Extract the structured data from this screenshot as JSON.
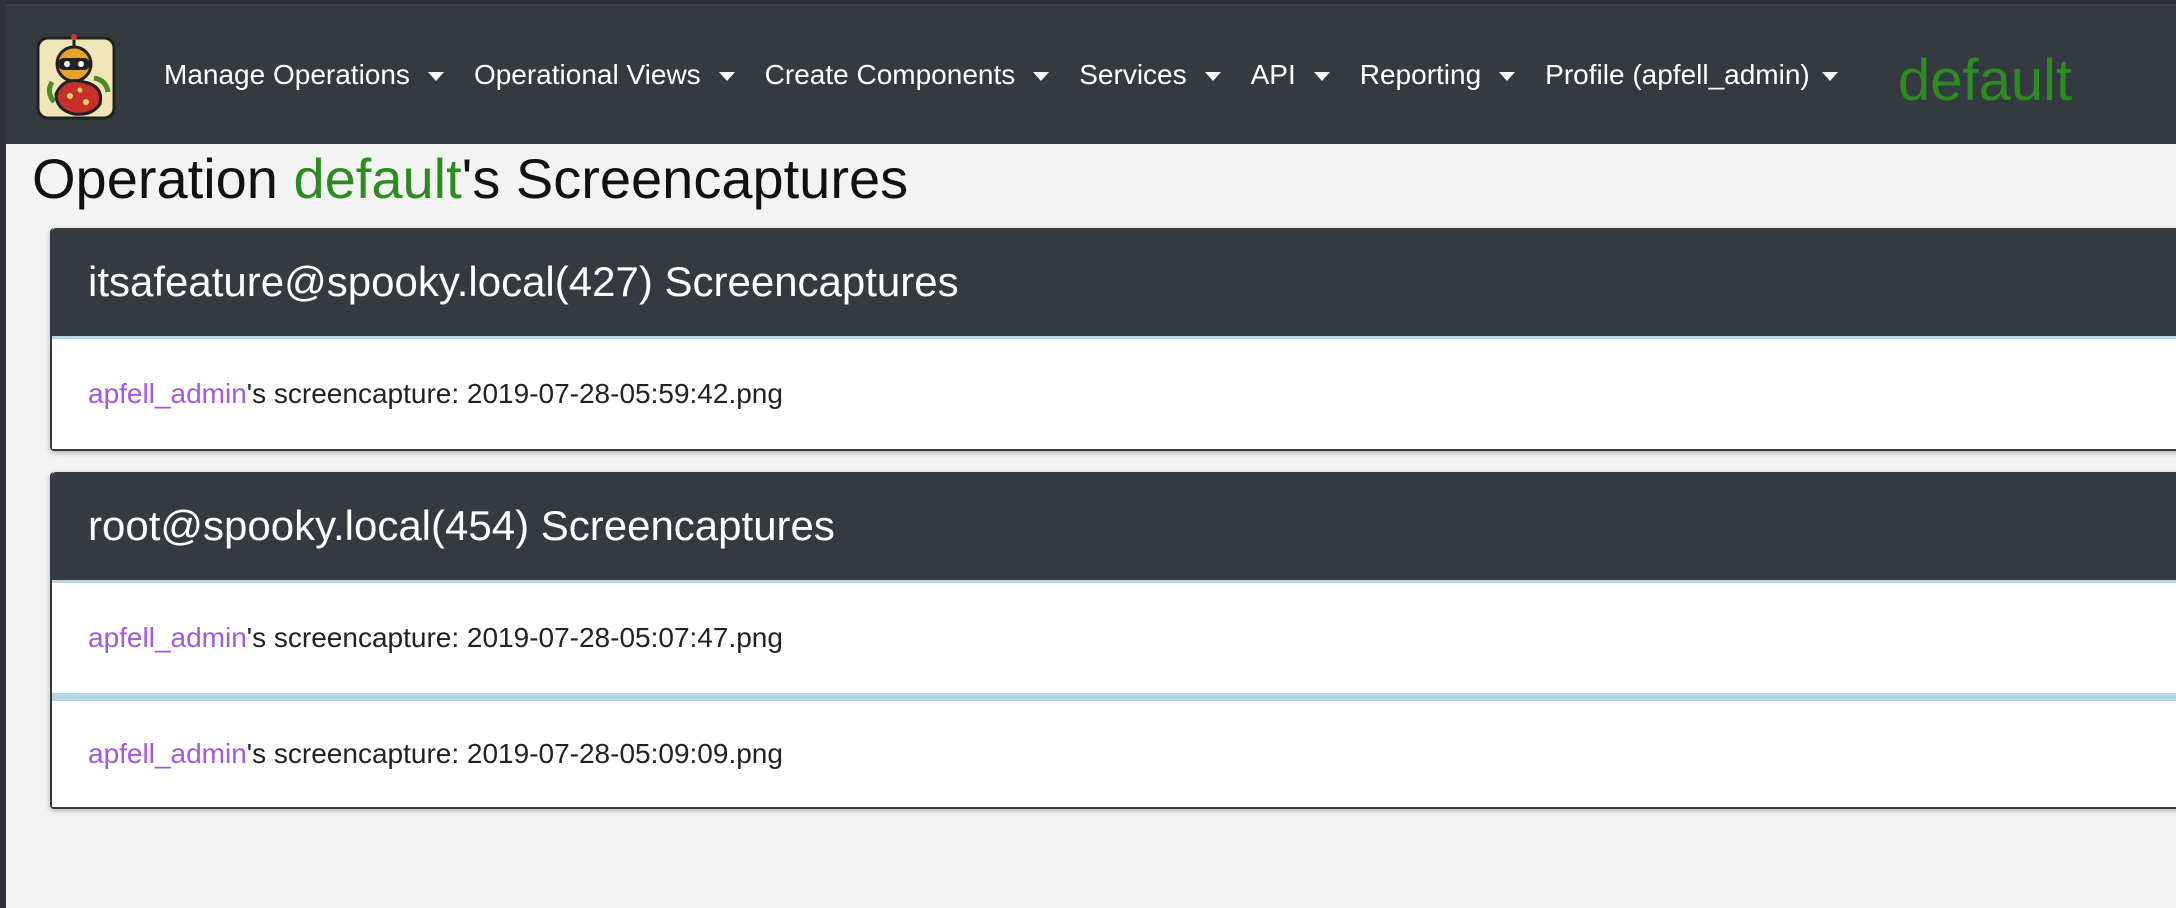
{
  "navbar": {
    "items": [
      {
        "label": "Manage Operations"
      },
      {
        "label": "Operational Views"
      },
      {
        "label": "Create Components"
      },
      {
        "label": "Services"
      },
      {
        "label": "API"
      },
      {
        "label": "Reporting"
      },
      {
        "label": "Profile (apfell_admin)"
      }
    ],
    "current_operation": "default"
  },
  "page": {
    "title_prefix": "Operation ",
    "operation_name": "default",
    "title_suffix": "'s Screencaptures"
  },
  "groups": [
    {
      "header": "itsafeature@spooky.local(427) Screencaptures",
      "items": [
        {
          "user": "apfell_admin",
          "text": "'s screencapture: 2019-07-28-05:59:42.png"
        }
      ]
    },
    {
      "header": "root@spooky.local(454) Screencaptures",
      "items": [
        {
          "user": "apfell_admin",
          "text": "'s screencapture: 2019-07-28-05:07:47.png"
        },
        {
          "user": "apfell_admin",
          "text": "'s screencapture: 2019-07-28-05:09:09.png"
        }
      ]
    }
  ],
  "colors": {
    "navbar_bg": "#343a40",
    "operation_green": "#2e8b22",
    "user_link_purple": "#a258e2",
    "row_separator": "#b5d5e4"
  }
}
